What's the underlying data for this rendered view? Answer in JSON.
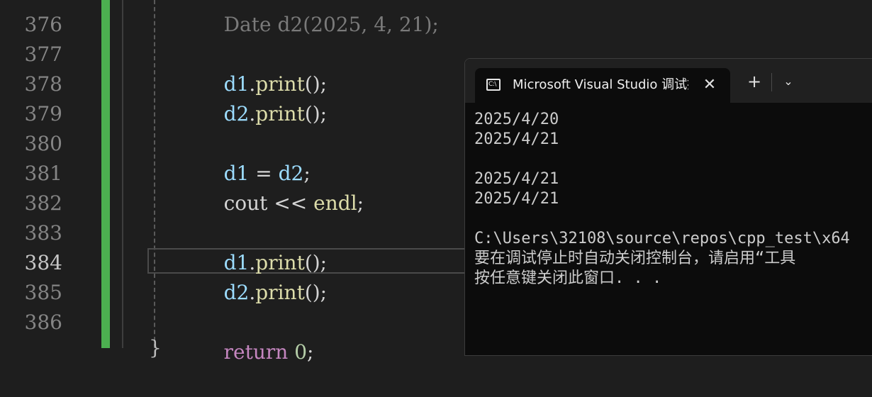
{
  "editor": {
    "line_numbers": [
      "376",
      "377",
      "378",
      "379",
      "380",
      "381",
      "382",
      "383",
      "384",
      "385",
      "386"
    ],
    "active_line": "384",
    "top_partial": {
      "type": "Date",
      "var": "d2",
      "args": "(2025, 4, 21);"
    },
    "lines": {
      "l377": {
        "var": "d1",
        "fn": "print",
        "rest": "();"
      },
      "l378": {
        "var": "d2",
        "fn": "print",
        "rest": "();"
      },
      "l380": {
        "lhs": "d1",
        "op": " = ",
        "rhs": "d2",
        "end": ";"
      },
      "l381": {
        "obj": "cout",
        "op": " << ",
        "val": "endl",
        "end": ";"
      },
      "l383": {
        "var": "d1",
        "fn": "print",
        "rest": "();"
      },
      "l384": {
        "var": "d2",
        "fn": "print",
        "rest": "();"
      },
      "l386": {
        "kw": "return",
        "num": "0",
        "end": ";"
      }
    },
    "brace": "}",
    "colors": {
      "change_bar": "#4caf50",
      "variable": "#9cdcfe",
      "function": "#dcdcaa",
      "keyword": "#c586c0"
    }
  },
  "terminal": {
    "icon": "console-icon",
    "icon_label": "C:\\",
    "tab_title": "Microsoft Visual Studio 调试控",
    "close_glyph": "✕",
    "new_tab_glyph": "+",
    "dropdown_glyph": "⌄",
    "output": [
      "2025/4/20",
      "2025/4/21",
      "",
      "2025/4/21",
      "2025/4/21",
      "",
      "C:\\Users\\32108\\source\\repos\\cpp_test\\x64",
      "要在调试停止时自动关闭控制台，请启用“工具",
      "按任意键关闭此窗口. . ."
    ]
  }
}
